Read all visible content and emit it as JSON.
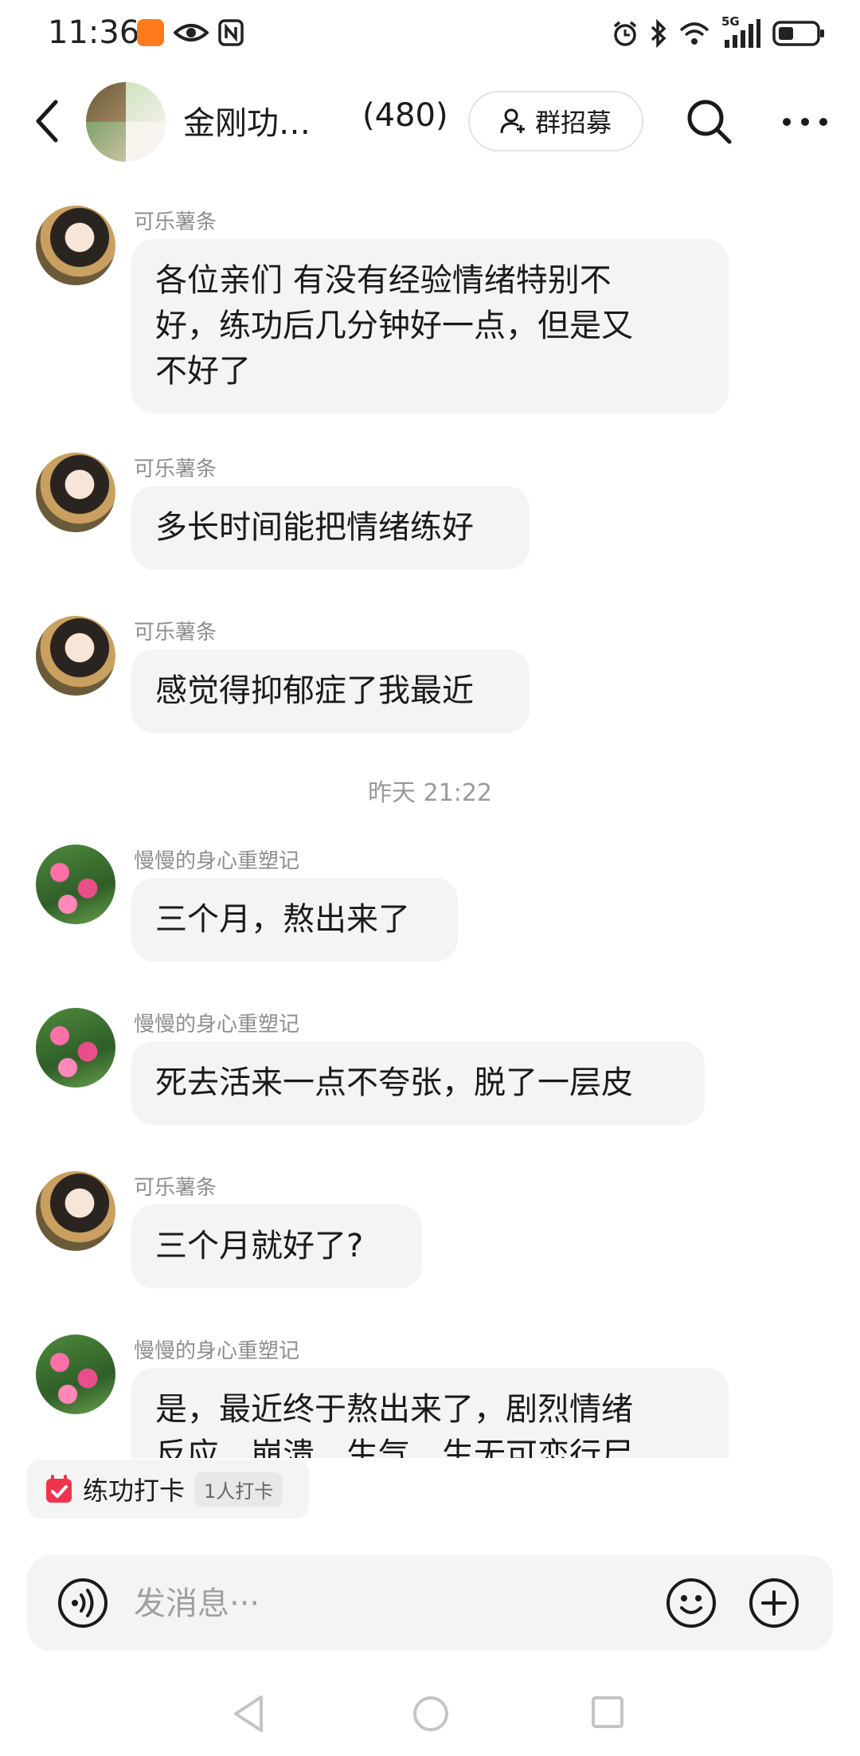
{
  "status_bar": {
    "time": "11:36",
    "network": "5G",
    "icons": [
      "app-badge-icon",
      "eye-icon",
      "nfc-icon",
      "alarm-icon",
      "bluetooth-icon",
      "wifi-icon",
      "signal-icon",
      "battery-icon"
    ]
  },
  "header": {
    "title": "金刚功…",
    "member_count": "(480)",
    "recruit_label": "群招募"
  },
  "messages": [
    {
      "sender": "可乐薯条",
      "avatar": "girl",
      "text": [
        "各位亲们 有没有经验情绪特别不",
        "好，练功后几分钟好一点，但是又",
        "不好了"
      ]
    },
    {
      "sender": "可乐薯条",
      "avatar": "girl",
      "text": [
        "多长时间能把情绪练好"
      ]
    },
    {
      "sender": "可乐薯条",
      "avatar": "girl",
      "text": [
        "感觉得抑郁症了我最近"
      ]
    },
    {
      "sender": "慢慢的身心重塑记",
      "avatar": "flower",
      "text": [
        "三个月，熬出来了"
      ]
    },
    {
      "sender": "慢慢的身心重塑记",
      "avatar": "flower",
      "text": [
        "死去活来一点不夸张，脱了一层皮"
      ]
    },
    {
      "sender": "可乐薯条",
      "avatar": "girl",
      "text": [
        "三个月就好了?"
      ]
    },
    {
      "sender": "慢慢的身心重塑记",
      "avatar": "flower",
      "text": [
        "是，最近终于熬出来了，剧烈情绪",
        "反应，崩溃，生气，生无可恋行尸"
      ]
    }
  ],
  "time_separator": "昨天 21:22",
  "checkin": {
    "label": "练功打卡",
    "count": "1人打卡"
  },
  "input": {
    "placeholder": "发消息···",
    "value": ""
  }
}
